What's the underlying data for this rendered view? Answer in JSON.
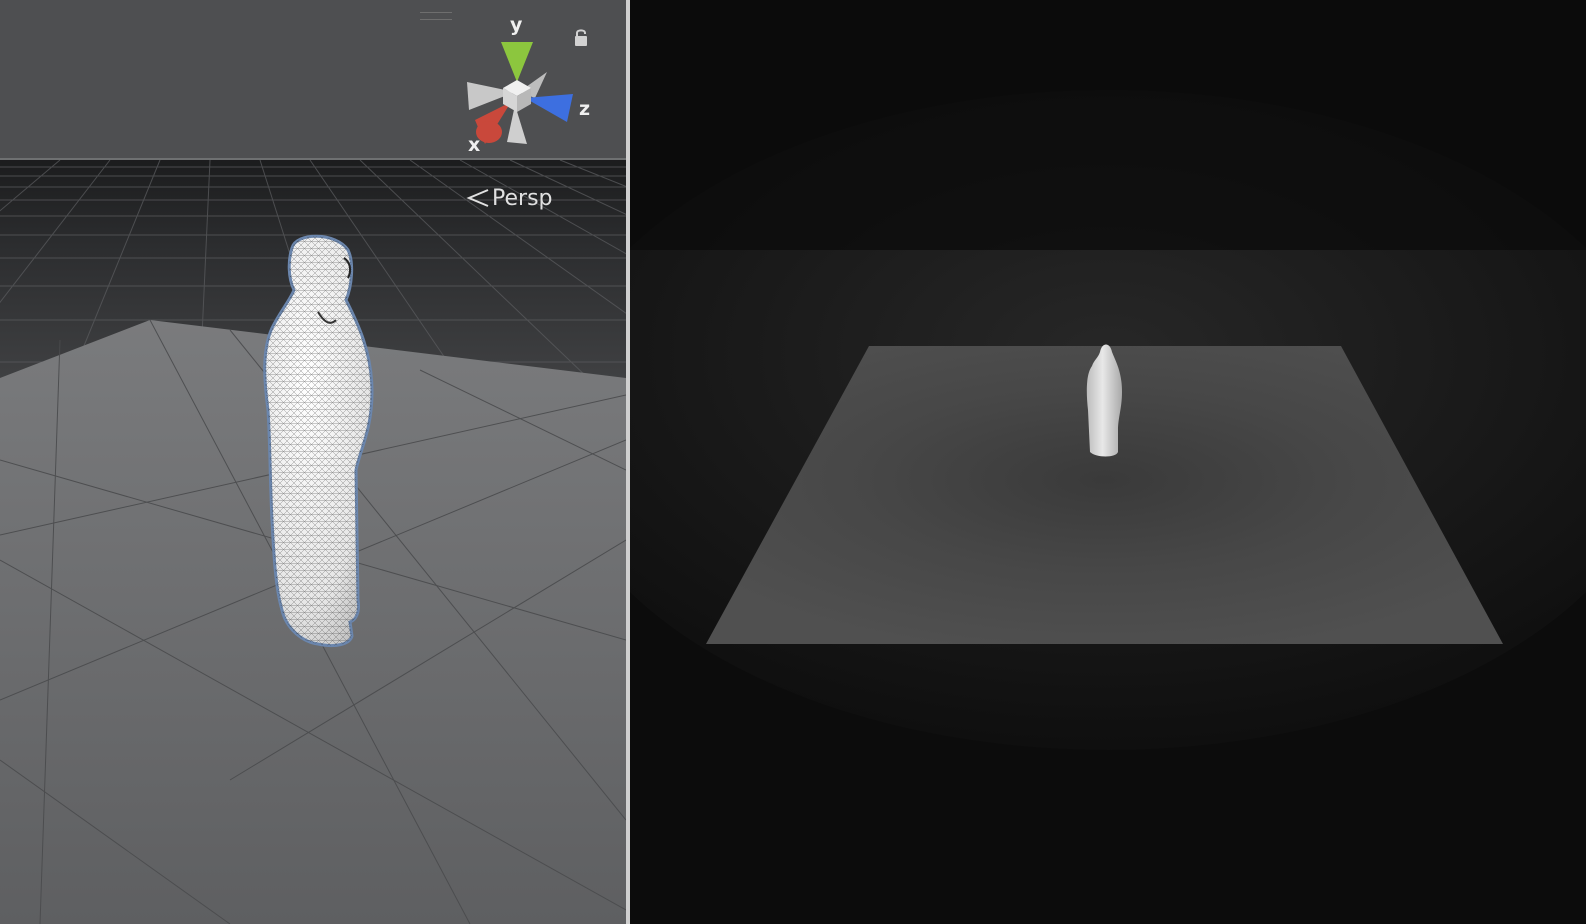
{
  "scene_view": {
    "gizmo": {
      "y_label": "y",
      "x_label": "x",
      "z_label": "z"
    },
    "projection_label": "Persp",
    "icons": {
      "lock": "lock-icon",
      "projection": "chevron-left-icon",
      "handle": "drag-handle"
    },
    "colors": {
      "background": "#4e4f51",
      "sky": "#4e4f51",
      "x_axis": "#c9483b",
      "y_axis": "#8cc63e",
      "z_axis": "#3d6fe0",
      "selection_outline": "#6b86ad"
    }
  },
  "game_view": {
    "colors": {
      "background": "#141414",
      "ground_plane": "#4b4b4b",
      "figure": "#cfcfcf"
    }
  }
}
